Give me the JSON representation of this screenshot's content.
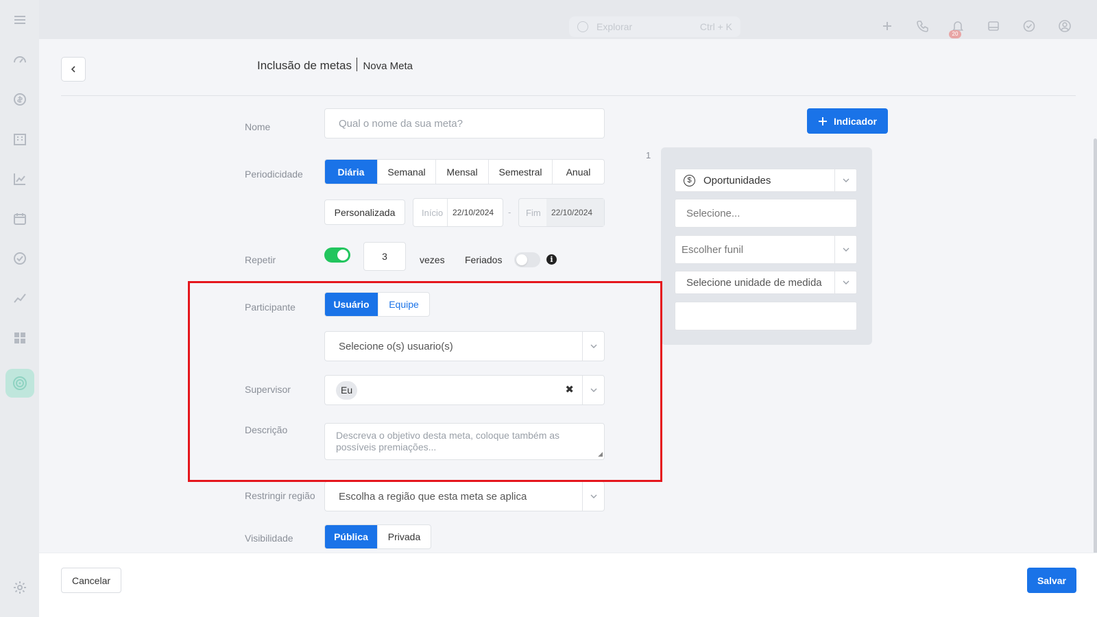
{
  "topbar": {
    "search_placeholder": "Explorar",
    "search_shortcut": "Ctrl + K",
    "notification_count": "20"
  },
  "header": {
    "title": "Inclusão de metas",
    "subtitle": "Nova Meta"
  },
  "form": {
    "nome": {
      "label": "Nome",
      "placeholder": "Qual o nome da sua meta?"
    },
    "periodicidade": {
      "label": "Periodicidade",
      "options": [
        "Diária",
        "Semanal",
        "Mensal",
        "Semestral",
        "Anual"
      ],
      "selected": "Diária",
      "custom_button": "Personalizada",
      "start_label": "Início",
      "start_date": "22/10/2024",
      "range_sep": "-",
      "end_label": "Fim",
      "end_date": "22/10/2024"
    },
    "repetir": {
      "label": "Repetir",
      "enabled": true,
      "times": "3",
      "times_unit": "vezes",
      "feriados_label": "Feriados",
      "feriados_enabled": false
    },
    "participante": {
      "label": "Participante",
      "options": [
        "Usuário",
        "Equipe"
      ],
      "selected": "Usuário",
      "users_placeholder": "Selecione o(s) usuario(s)"
    },
    "supervisor": {
      "label": "Supervisor",
      "value": "Eu"
    },
    "descricao": {
      "label": "Descrição",
      "placeholder": "Descreva o objetivo desta meta, coloque também as possíveis premiações..."
    },
    "restringir_regiao": {
      "label": "Restringir região",
      "placeholder": "Escolha a região que esta meta se aplica"
    },
    "visibilidade": {
      "label": "Visibilidade",
      "options": [
        "Pública",
        "Privada"
      ],
      "selected": "Pública"
    }
  },
  "indicator": {
    "add_button": "Indicador",
    "index": "1",
    "type": "Oportunidades",
    "select_placeholder": "Selecione...",
    "funnel_placeholder": "Escolher funil",
    "unit_placeholder": "Selecione unidade de medida",
    "value": ""
  },
  "footer": {
    "cancel": "Cancelar",
    "save": "Salvar"
  },
  "colors": {
    "primary": "#1a73e8",
    "toggle_on": "#22c55e",
    "highlight": "#e5161d"
  }
}
